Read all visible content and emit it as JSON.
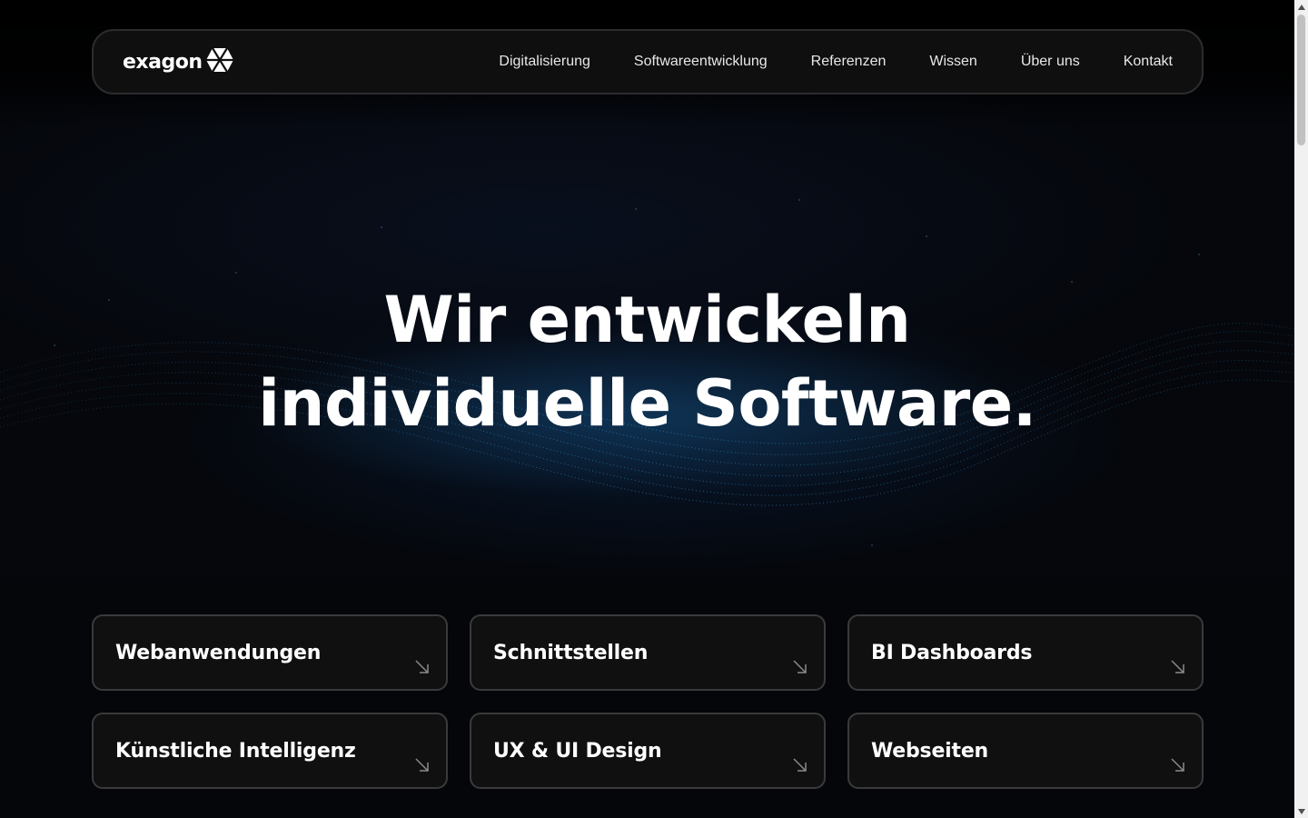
{
  "brand": {
    "name": "exagon",
    "logo_icon": "hexagon-icon"
  },
  "nav": {
    "items": [
      {
        "label": "Digitalisierung"
      },
      {
        "label": "Softwareentwicklung"
      },
      {
        "label": "Referenzen"
      },
      {
        "label": "Wissen"
      },
      {
        "label": "Über uns"
      },
      {
        "label": "Kontakt"
      }
    ]
  },
  "hero": {
    "line1": "Wir entwickeln",
    "line2": "individuelle Software."
  },
  "services": [
    {
      "label": "Webanwendungen",
      "icon": "arrow-down-right-icon"
    },
    {
      "label": "Schnittstellen",
      "icon": "arrow-down-right-icon"
    },
    {
      "label": "BI Dashboards",
      "icon": "arrow-down-right-icon"
    },
    {
      "label": "Künstliche Intelligenz",
      "icon": "arrow-down-right-icon"
    },
    {
      "label": "UX & UI Design",
      "icon": "arrow-down-right-icon"
    },
    {
      "label": "Webseiten",
      "icon": "arrow-down-right-icon"
    }
  ],
  "colors": {
    "background": "#000000",
    "card_bg": "#101011",
    "card_border": "#3a3a3c",
    "accent_wave": "#1e6eaa"
  }
}
